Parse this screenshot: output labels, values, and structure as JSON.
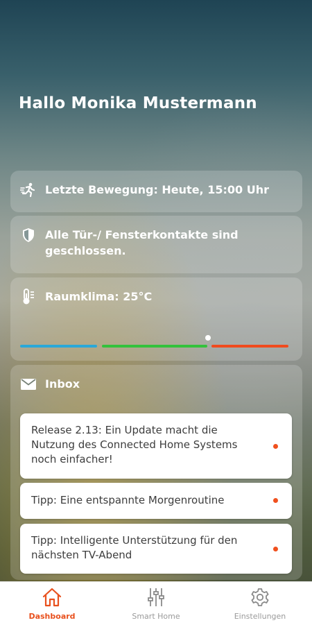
{
  "greeting": "Hallo Monika Mustermann",
  "cards": {
    "motion": {
      "icon": "running-person-icon",
      "label": "Letzte Bewegung: Heute, 15:00 Uhr"
    },
    "doors": {
      "icon": "shield-icon",
      "label": "Alle Tür-/ Fensterkontakte sind geschlossen."
    },
    "climate": {
      "icon": "thermometer-icon",
      "label": "Raumklima: 25°C"
    },
    "inbox": {
      "icon": "mail-icon",
      "label": "Inbox",
      "messages": [
        {
          "text": "Release 2.13: Ein Update macht die Nutzung des Connected Home Systems noch einfacher!",
          "unread": true
        },
        {
          "text": "Tipp: Eine entspannte Morgenroutine",
          "unread": true
        },
        {
          "text": "Tipp: Intelligente Unterstützung für den nächsten TV-Abend",
          "unread": true
        }
      ]
    }
  },
  "temperature_scale": {
    "segments": [
      {
        "name": "cold",
        "color": "#2aa8d8"
      },
      {
        "name": "comfort",
        "color": "#33c23c"
      },
      {
        "name": "warm",
        "color": "#f04b1e"
      }
    ],
    "marker_fraction": 0.7
  },
  "nav": {
    "items": [
      {
        "label": "Dashboard",
        "icon": "house-icon",
        "active": true
      },
      {
        "label": "Smart Home",
        "icon": "sliders-icon",
        "active": false
      },
      {
        "label": "Einstellungen",
        "icon": "gear-icon",
        "active": false
      }
    ]
  },
  "colors": {
    "accent": "#e8501d",
    "unread_dot": "#f0501e"
  }
}
